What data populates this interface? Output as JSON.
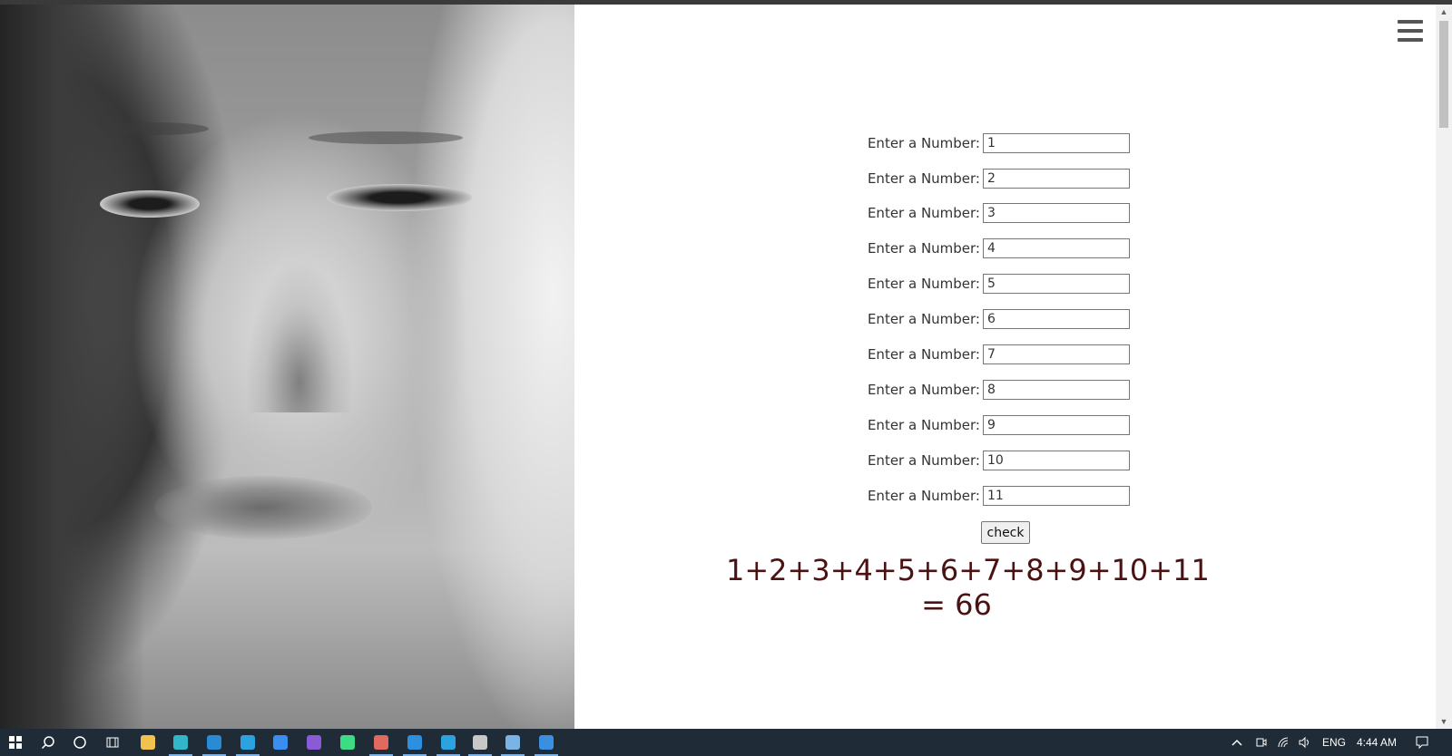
{
  "form": {
    "field_label": "Enter a Number:",
    "values": [
      "1",
      "2",
      "3",
      "4",
      "5",
      "6",
      "7",
      "8",
      "9",
      "10",
      "11"
    ]
  },
  "button": {
    "check_label": "check"
  },
  "result": {
    "text": "1+2+3+4+5+6+7+8+9+10+11 = 66"
  },
  "menu": {
    "icon": "hamburger-menu-icon"
  },
  "taskbar": {
    "apps": [
      {
        "name": "start-icon",
        "color": "#ffffff"
      },
      {
        "name": "search-icon",
        "color": "#ffffff"
      },
      {
        "name": "cortana-icon",
        "color": "#ffffff"
      },
      {
        "name": "task-view-icon",
        "color": "#ffffff"
      },
      {
        "name": "file-explorer-icon",
        "color": "#f2c14e"
      },
      {
        "name": "edge-browser-icon",
        "color": "#33b6c9"
      },
      {
        "name": "mail-icon",
        "color": "#2a8ad4"
      },
      {
        "name": "telegram-icon",
        "color": "#2aa3df"
      },
      {
        "name": "messenger-icon",
        "color": "#3a8ef0"
      },
      {
        "name": "visual-studio-icon",
        "color": "#8b5ad6"
      },
      {
        "name": "android-studio-icon",
        "color": "#3ddc84"
      },
      {
        "name": "paint-icon",
        "color": "#e06a5f"
      },
      {
        "name": "vscode-icon",
        "color": "#2d8fe0"
      },
      {
        "name": "telegram-icon-2",
        "color": "#2aa3df"
      },
      {
        "name": "terminal-icon",
        "color": "#c8c8c8"
      },
      {
        "name": "notepad-icon",
        "color": "#7ab4e6"
      },
      {
        "name": "media-player-icon",
        "color": "#3b8fe0"
      }
    ],
    "tray": {
      "language": "ENG",
      "time": "4:44 AM"
    }
  }
}
